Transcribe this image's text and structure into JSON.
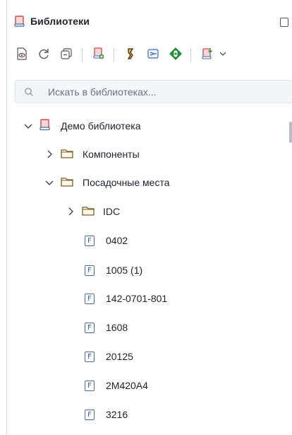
{
  "panel": {
    "title": "Библиотеки"
  },
  "search": {
    "placeholder": "Искать в библиотеках..."
  },
  "tree": {
    "root": {
      "label": "Демо библиотека",
      "expanded": true
    },
    "components": {
      "label": "Компоненты",
      "expanded": false
    },
    "footprints": {
      "label": "Посадочные места",
      "expanded": true
    },
    "idc": {
      "label": "IDC",
      "expanded": false
    },
    "items": [
      {
        "label": "0402",
        "icon": "F"
      },
      {
        "label": "1005 (1)",
        "icon": "F"
      },
      {
        "label": "142-0701-801",
        "icon": "F"
      },
      {
        "label": "1608",
        "icon": "F"
      },
      {
        "label": "20125",
        "icon": "F"
      },
      {
        "label": "2M420A4",
        "icon": "F"
      },
      {
        "label": "3216",
        "icon": "F"
      }
    ]
  },
  "colors": {
    "library_red": "#d9484b",
    "folder": "#7a5f2a",
    "accent_green": "#2e8b3a",
    "accent_orange": "#c98a12",
    "accent_blue": "#2f6fb3"
  }
}
